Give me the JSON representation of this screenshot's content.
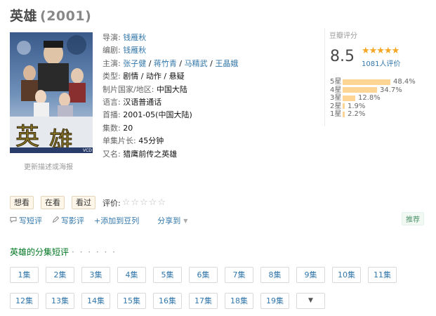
{
  "title": "英雄",
  "year": "(2001)",
  "poster": {
    "alt": "英雄 poster",
    "title_glyphs": "英雄",
    "bottom_text": "VCD"
  },
  "update_link": "更新描述或海报",
  "info": {
    "director_label": "导演:",
    "director": "钱雁秋",
    "writer_label": "编剧:",
    "writer": "钱雁秋",
    "cast_label": "主演:",
    "cast": [
      "张子健",
      "蒋竹青",
      "马精武",
      "王晶娥"
    ],
    "genre_label": "类型:",
    "genre": "剧情 / 动作 / 悬疑",
    "region_label": "制片国家/地区:",
    "region": "中国大陆",
    "language_label": "语言:",
    "language": "汉语普通话",
    "premiere_label": "首播:",
    "premiere": "2001-05(中国大陆)",
    "episodes_label": "集数:",
    "episodes": "20",
    "runtime_label": "单集片长:",
    "runtime": "45分钟",
    "aka_label": "又名:",
    "aka": "猎鹰前传之英雄"
  },
  "rating": {
    "title": "豆瓣评分",
    "score": "8.5",
    "stars": "★★★★★",
    "count": "1081人评价",
    "distribution": [
      {
        "label": "5星",
        "pct": "48.4%",
        "value": 48.4
      },
      {
        "label": "4星",
        "pct": "34.7%",
        "value": 34.7
      },
      {
        "label": "3星",
        "pct": "12.8%",
        "value": 12.8
      },
      {
        "label": "2星",
        "pct": "1.9%",
        "value": 1.9
      },
      {
        "label": "1星",
        "pct": "2.2%",
        "value": 2.2
      }
    ]
  },
  "buttons": {
    "want": "想看",
    "watching": "在看",
    "watched": "看过",
    "rate_label": "评价:",
    "rate_stars": "☆☆☆☆☆"
  },
  "actions": {
    "short_review": "写短评",
    "review": "写影评",
    "add_doulist": "+添加到豆列",
    "share": "分享到",
    "recommend": "推荐"
  },
  "episodes_section": {
    "title": "英雄的分集短评",
    "dots": "· · · · · ·",
    "items": [
      "1集",
      "2集",
      "3集",
      "4集",
      "5集",
      "6集",
      "7集",
      "8集",
      "9集",
      "10集",
      "11集",
      "12集",
      "13集",
      "14集",
      "15集",
      "16集",
      "17集",
      "18集",
      "19集"
    ],
    "more": "▼"
  },
  "colors": {
    "link": "#3377aa",
    "star": "#f5a623",
    "bar": "#ffd596",
    "section_green": "#007722"
  }
}
